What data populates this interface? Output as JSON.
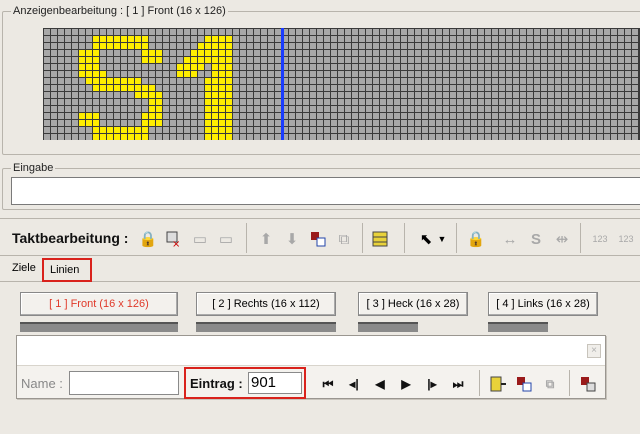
{
  "display_editor": {
    "title": "Anzeigenbearbeitung : [ 1 ]   Front (16 x 126)",
    "led": {
      "rows": 16,
      "cols": 126,
      "on_color": "#ffee00",
      "off_color": "#a8a8a8",
      "bg_color": "#3a3a3a",
      "cursor_color": "#1a3cff",
      "cursor_col": 34,
      "text": "S1"
    }
  },
  "input_group": {
    "title": "Eingabe",
    "value": ""
  },
  "toolbar": {
    "label": "Taktbearbeitung :",
    "icons": [
      "lock-icon",
      "delete-icon",
      "move-left-icon",
      "move-right-icon",
      "arrow-up-icon",
      "arrow-down-icon",
      "paste-icon",
      "copy-icon",
      "database-icon",
      "select-tool-icon",
      "dropdown-icon",
      "lock-disabled-icon",
      "expand-icon",
      "s-icon",
      "compress-icon",
      "numbers-up-icon",
      "numbers-down-icon"
    ]
  },
  "tabs": [
    {
      "label": "Ziele"
    },
    {
      "label": "Linien",
      "active": true
    }
  ],
  "display_buttons": [
    {
      "label": "[ 1 ]   Front (16 x 126)",
      "active": true
    },
    {
      "label": "[ 2 ]   Rechts (16 x 112)"
    },
    {
      "label": "[ 3 ]   Heck (16 x 28)"
    },
    {
      "label": "[ 4 ]   Links (16 x 28)"
    }
  ],
  "panel": {
    "name_label": "Name :",
    "name_value": "",
    "eintrag_label": "Eintrag :",
    "eintrag_value": "901",
    "close_glyph": "×",
    "nav": [
      "first",
      "prev-step",
      "prev",
      "next",
      "next-step",
      "last"
    ]
  }
}
